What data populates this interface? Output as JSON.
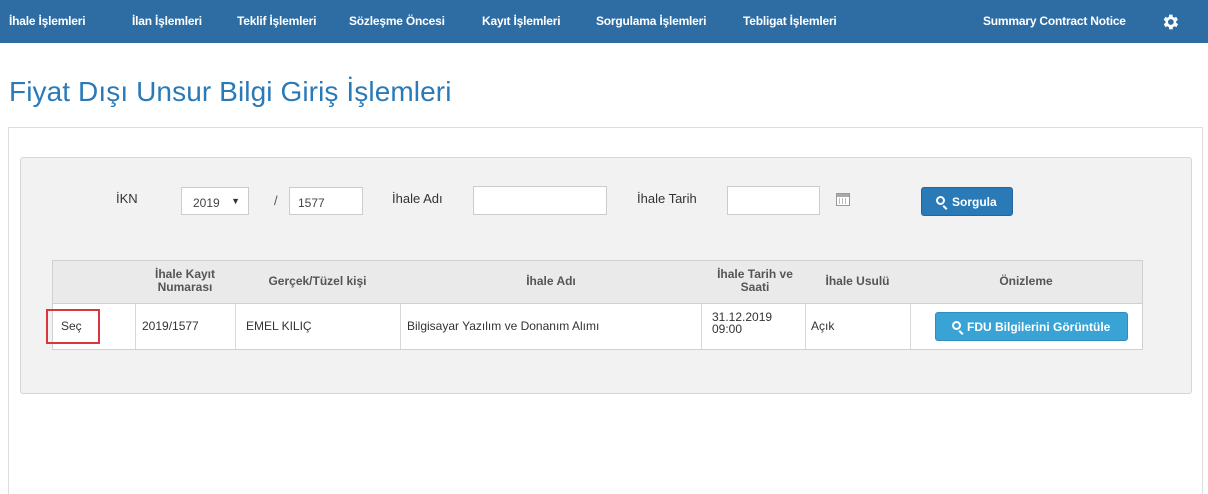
{
  "nav": {
    "items": [
      {
        "label": "İhale İşlemleri"
      },
      {
        "label": "İlan İşlemleri"
      },
      {
        "label": "Teklif İşlemleri"
      },
      {
        "label": "Sözleşme Öncesi"
      },
      {
        "label": "Kayıt İşlemleri"
      },
      {
        "label": "Sorgulama İşlemleri"
      },
      {
        "label": "Tebligat İşlemleri"
      }
    ],
    "summary_label": "Summary Contract Notice",
    "settings_icon": "gear-icon"
  },
  "page": {
    "title": "Fiyat Dışı Unsur Bilgi Giriş İşlemleri"
  },
  "search": {
    "ikn_label": "İKN",
    "year_value": "2019",
    "separator": "/",
    "number_value": "1577",
    "ihale_adi_label": "İhale Adı",
    "ihale_adi_value": "",
    "ihale_tarih_label": "İhale Tarih",
    "ihale_tarih_value": "",
    "calendar_icon": "calendar-icon",
    "button_label": "Sorgula",
    "button_icon": "search-icon"
  },
  "table": {
    "headers": {
      "kayit_no": "İhale Kayıt Numarası",
      "kisi": "Gerçek/Tüzel kişi",
      "ihale_adi": "İhale Adı",
      "tarih": "İhale Tarih ve Saati",
      "usul": "İhale Usulü",
      "onizleme": "Önizleme"
    },
    "rows": [
      {
        "sec": "Seç",
        "kayit_no": "2019/1577",
        "kisi": "EMEL KILIÇ",
        "ihale_adi": "Bilgisayar Yazılım ve Donanım Alımı",
        "tarih_line1": "31.12.2019",
        "tarih_line2": "09:00",
        "usul": "Açık",
        "preview_button": "FDU Bilgilerini Görüntüle"
      }
    ]
  },
  "colors": {
    "navbar": "#2e6da4",
    "title": "#2a7ab8",
    "primary_button": "#2a7ab8",
    "info_button": "#3aa3d5",
    "highlight_box": "#d9363e"
  }
}
